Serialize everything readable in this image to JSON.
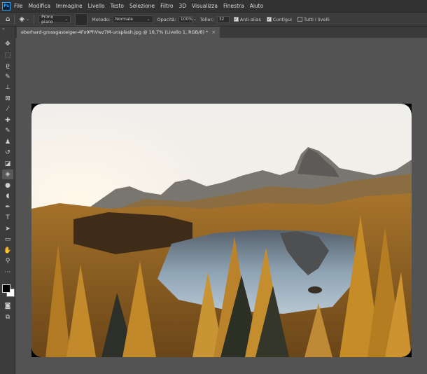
{
  "menubar": {
    "logo": "Ps",
    "items": [
      "File",
      "Modifica",
      "Immagine",
      "Livello",
      "Testo",
      "Selezione",
      "Filtro",
      "3D",
      "Visualizza",
      "Finestra",
      "Aiuto"
    ]
  },
  "options": {
    "fill_source": "Primo piano",
    "mode_label": "Metodo:",
    "mode_value": "Normale",
    "opacity_label": "Opacità:",
    "opacity_value": "100%",
    "tolerance_label": "Toller.:",
    "tolerance_value": "32",
    "antialias_label": "Anti-alias",
    "antialias_checked": true,
    "contiguous_label": "Contigui",
    "contiguous_checked": true,
    "all_layers_label": "Tutti i livelli",
    "all_layers_checked": false
  },
  "document": {
    "tab_title": "eberhard-grossgasteiger-4Fo9PhVwz7M-unsplash.jpg @ 16,7% (Livello 1, RGB/8) *",
    "close_glyph": "×"
  },
  "toolbar": {
    "grip": "»",
    "tools": [
      {
        "name": "move-tool",
        "glyph": "✥"
      },
      {
        "name": "marquee-tool",
        "glyph": "⬚"
      },
      {
        "name": "lasso-tool",
        "glyph": "ϱ"
      },
      {
        "name": "quick-selection-tool",
        "glyph": "✎"
      },
      {
        "name": "crop-tool",
        "glyph": "⊥"
      },
      {
        "name": "frame-tool",
        "glyph": "⊠"
      },
      {
        "name": "eyedropper-tool",
        "glyph": "⁄"
      },
      {
        "name": "healing-brush-tool",
        "glyph": "✚"
      },
      {
        "name": "brush-tool",
        "glyph": "✎"
      },
      {
        "name": "clone-stamp-tool",
        "glyph": "♟"
      },
      {
        "name": "history-brush-tool",
        "glyph": "↺"
      },
      {
        "name": "eraser-tool",
        "glyph": "◪"
      },
      {
        "name": "paint-bucket-tool",
        "glyph": "◈"
      },
      {
        "name": "blur-tool",
        "glyph": "●"
      },
      {
        "name": "dodge-tool",
        "glyph": "◖"
      },
      {
        "name": "pen-tool",
        "glyph": "✒"
      },
      {
        "name": "type-tool",
        "glyph": "T"
      },
      {
        "name": "path-selection-tool",
        "glyph": "➤"
      },
      {
        "name": "rectangle-tool",
        "glyph": "▭"
      },
      {
        "name": "hand-tool",
        "glyph": "✋"
      },
      {
        "name": "zoom-tool",
        "glyph": "⚲"
      },
      {
        "name": "more-tools",
        "glyph": "···"
      }
    ],
    "active_tool": "paint-bucket-tool",
    "bottom_tools": [
      {
        "name": "quick-mask-tool",
        "glyph": "◙"
      },
      {
        "name": "screen-mode-tool",
        "glyph": "⧉"
      }
    ]
  }
}
